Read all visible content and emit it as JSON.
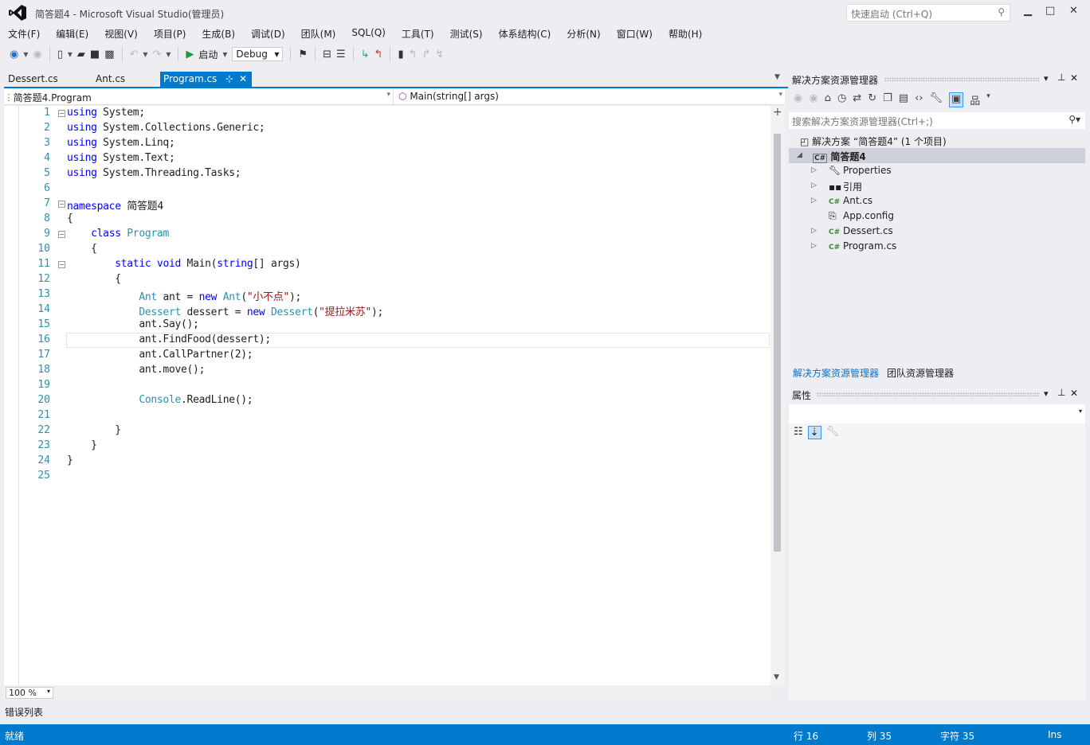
{
  "window": {
    "title": "简答题4 - Microsoft Visual Studio(管理员)",
    "quick_launch": "快速启动 (Ctrl+Q)"
  },
  "menu": [
    "文件(F)",
    "编辑(E)",
    "视图(V)",
    "项目(P)",
    "生成(B)",
    "调试(D)",
    "团队(M)",
    "SQL(Q)",
    "工具(T)",
    "测试(S)",
    "体系结构(C)",
    "分析(N)",
    "窗口(W)",
    "帮助(H)"
  ],
  "toolbar": {
    "start_label": "启动",
    "config": "Debug"
  },
  "tabs": [
    {
      "label": "Dessert.cs"
    },
    {
      "label": "Ant.cs"
    },
    {
      "label": "Program.cs",
      "active": true
    }
  ],
  "navbar": {
    "type": "简答题4.Program",
    "member": "Main(string[] args)"
  },
  "code": [
    [
      [
        "using",
        "kw"
      ],
      [
        " System;",
        ""
      ]
    ],
    [
      [
        "using",
        "kw"
      ],
      [
        " System.Collections.Generic;",
        ""
      ]
    ],
    [
      [
        "using",
        "kw"
      ],
      [
        " System.Linq;",
        ""
      ]
    ],
    [
      [
        "using",
        "kw"
      ],
      [
        " System.Text;",
        ""
      ]
    ],
    [
      [
        "using",
        "kw"
      ],
      [
        " System.Threading.Tasks;",
        ""
      ]
    ],
    [],
    [
      [
        "namespace",
        "kw"
      ],
      [
        " 简答题4",
        ""
      ]
    ],
    [
      [
        "{",
        ""
      ]
    ],
    [
      [
        "    ",
        ""
      ],
      [
        "class",
        "kw"
      ],
      [
        " ",
        ""
      ],
      [
        "Program",
        "ty"
      ]
    ],
    [
      [
        "    {",
        ""
      ]
    ],
    [
      [
        "        ",
        ""
      ],
      [
        "static",
        "kw"
      ],
      [
        " ",
        ""
      ],
      [
        "void",
        "kw"
      ],
      [
        " Main(",
        ""
      ],
      [
        "string",
        "kw"
      ],
      [
        "[] args)",
        ""
      ]
    ],
    [
      [
        "        {",
        ""
      ]
    ],
    [
      [
        "            ",
        ""
      ],
      [
        "Ant",
        "ty"
      ],
      [
        " ant = ",
        ""
      ],
      [
        "new",
        "kw"
      ],
      [
        " ",
        ""
      ],
      [
        "Ant",
        "ty"
      ],
      [
        "(",
        ""
      ],
      [
        "\"小不点\"",
        "st"
      ],
      [
        ");",
        ""
      ]
    ],
    [
      [
        "            ",
        ""
      ],
      [
        "Dessert",
        "ty"
      ],
      [
        " dessert = ",
        ""
      ],
      [
        "new",
        "kw"
      ],
      [
        " ",
        ""
      ],
      [
        "Dessert",
        "ty"
      ],
      [
        "(",
        ""
      ],
      [
        "\"提拉米苏\"",
        "st"
      ],
      [
        ");",
        ""
      ]
    ],
    [
      [
        "            ant.Say();",
        ""
      ]
    ],
    [
      [
        "            ant.FindFood(dessert);",
        ""
      ]
    ],
    [
      [
        "            ant.CallPartner(2);",
        ""
      ]
    ],
    [
      [
        "            ant.move();",
        ""
      ]
    ],
    [],
    [
      [
        "            ",
        ""
      ],
      [
        "Console",
        "ty"
      ],
      [
        ".ReadLine();",
        ""
      ]
    ],
    [],
    [
      [
        "        }",
        ""
      ]
    ],
    [
      [
        "    }",
        ""
      ]
    ],
    [
      [
        "}",
        ""
      ]
    ],
    []
  ],
  "editor": {
    "zoom": "100 %"
  },
  "solution_explorer": {
    "title": "解决方案资源管理器",
    "search_placeholder": "搜索解决方案资源管理器(Ctrl+;)",
    "solution": "解决方案 “简答题4” (1 个项目)",
    "project": "简答题4",
    "items": [
      "Properties",
      "引用",
      "Ant.cs",
      "App.config",
      "Dessert.cs",
      "Program.cs"
    ]
  },
  "bottom_tabs": [
    "解决方案资源管理器",
    "团队资源管理器"
  ],
  "properties": {
    "title": "属性"
  },
  "error_list": "错误列表",
  "status": {
    "ready": "就绪",
    "line": "行 16",
    "col": "列 35",
    "char": "字符 35",
    "mode": "Ins"
  },
  "colors": {
    "accent": "#007acc",
    "keyword": "#0000ff",
    "type": "#2b91af",
    "string": "#a31515"
  }
}
